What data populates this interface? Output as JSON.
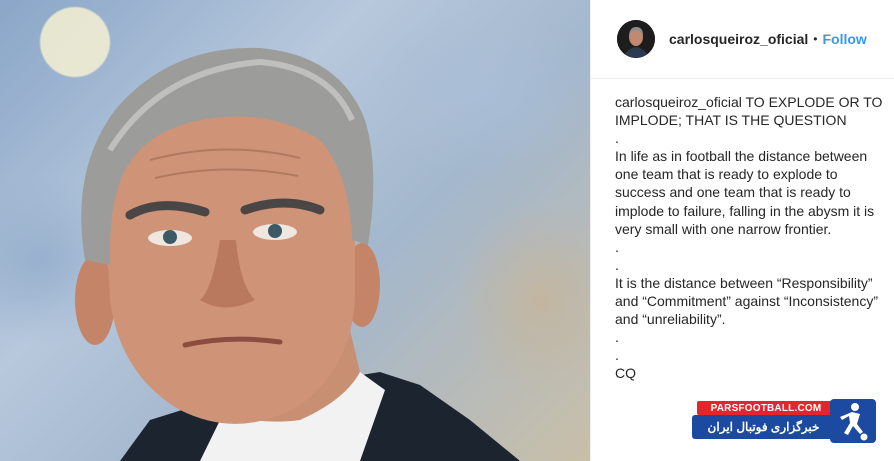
{
  "post": {
    "username": "carlosqueiroz_oficial",
    "separator": "•",
    "follow_label": "Follow"
  },
  "caption": {
    "lines": [
      "TO EXPLODE OR TO",
      "IMPLODE; THAT IS THE QUESTION",
      ".",
      "In life as in football the distance between",
      "one team that is ready to explode to",
      "success and one team that is ready to",
      "implode to failure, falling in the abysm it is",
      "very small with one narrow frontier.",
      ".",
      ".",
      "It is the distance between “Responsibility”",
      "and “Commitment” against “Inconsistency”",
      "and “unreliability”.",
      ".",
      ".",
      "CQ"
    ]
  },
  "watermark": {
    "site": "PARSFOOTBALL.COM",
    "tagline": "خبرگزاری فوتبال ایران"
  },
  "colors": {
    "follow": "#3897f0",
    "watermark_red": "#e4262c",
    "watermark_blue": "#1b4aa0"
  }
}
